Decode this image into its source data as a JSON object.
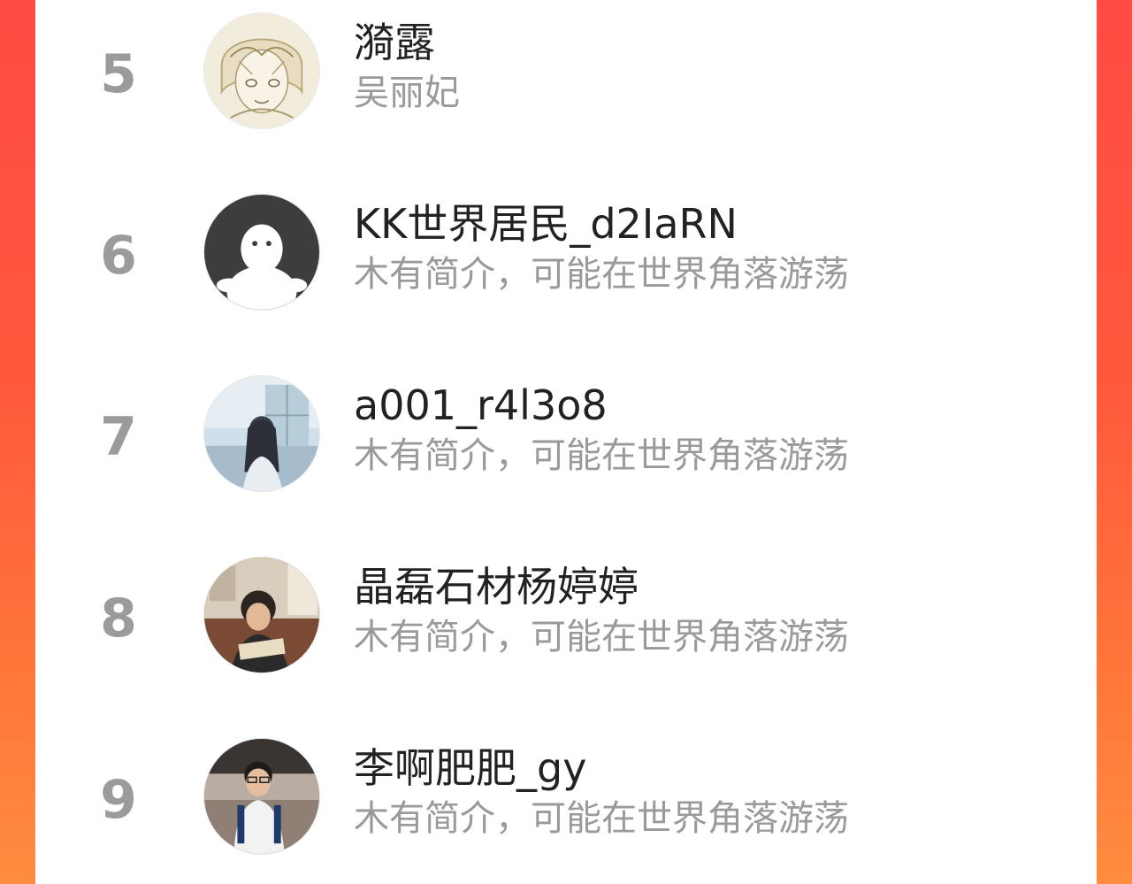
{
  "colors": {
    "background_gradient_start": "#ff4b44",
    "background_gradient_end": "#ff8c3f",
    "panel": "#ffffff",
    "rank_number": "#9b9b9b",
    "name_text": "#222222",
    "bio_text": "#9a9a9a"
  },
  "ranking": [
    {
      "rank": "5",
      "name": "漪露",
      "bio": "吴丽妃",
      "avatar": "sketch-anime-avatar"
    },
    {
      "rank": "6",
      "name": "KK世界居民_d2IaRN",
      "bio": "木有简介，可能在世界角落游荡",
      "avatar": "default-ghost-avatar"
    },
    {
      "rank": "7",
      "name": "a001_r4l3o8",
      "bio": "木有简介，可能在世界角落游荡",
      "avatar": "photo-girl-window-avatar"
    },
    {
      "rank": "8",
      "name": "晶磊石材杨婷婷",
      "bio": "木有简介，可能在世界角落游荡",
      "avatar": "photo-reading-girl-avatar"
    },
    {
      "rank": "9",
      "name": "李啊肥肥_gy",
      "bio": "木有简介，可能在世界角落游荡",
      "avatar": "photo-boy-backpack-avatar"
    }
  ]
}
